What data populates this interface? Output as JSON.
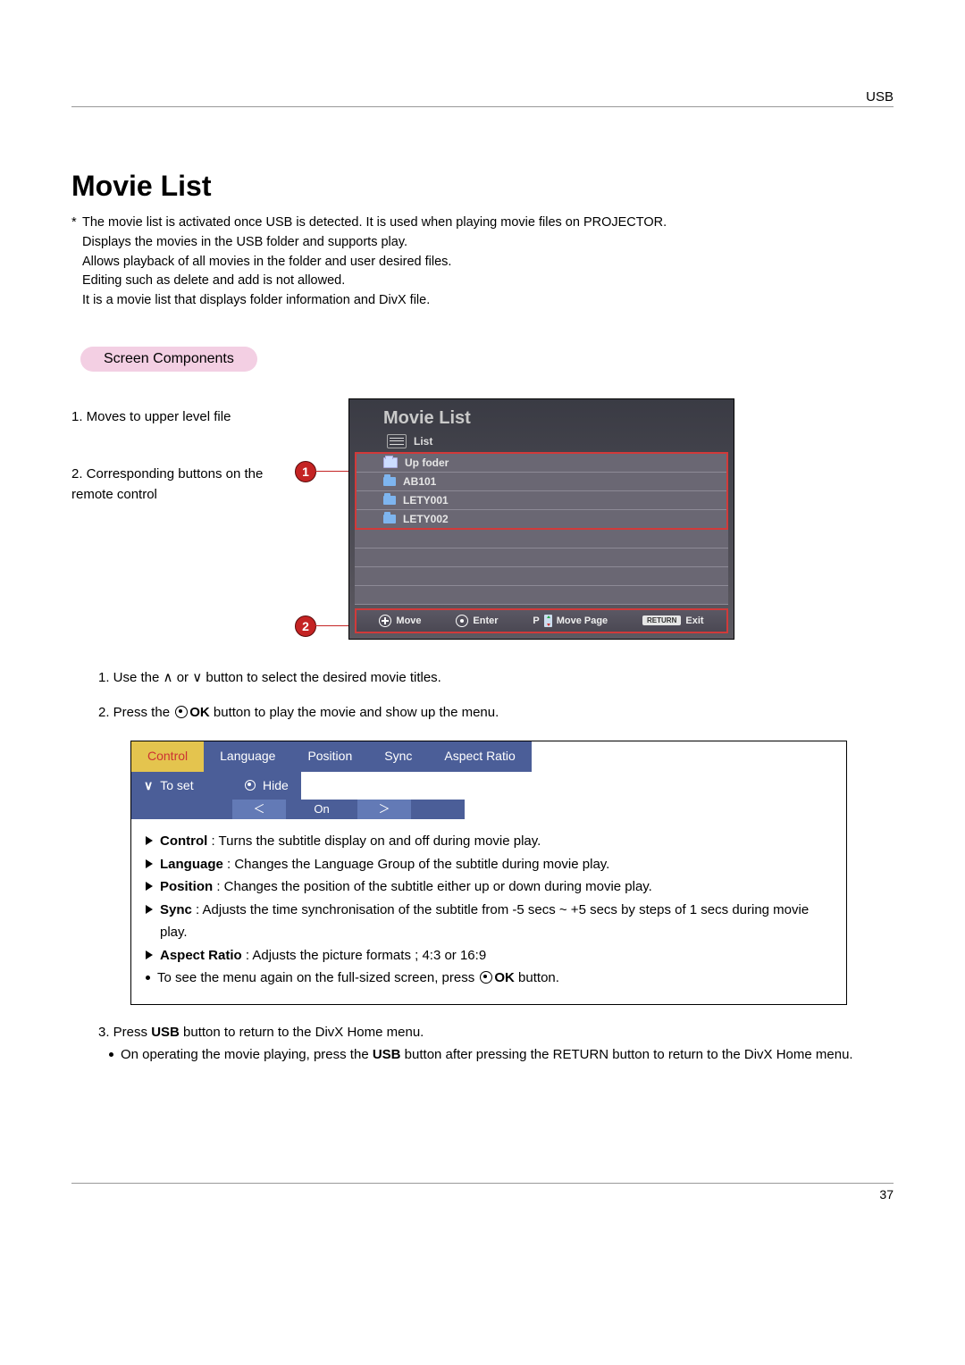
{
  "header": {
    "section": "USB"
  },
  "title": "Movie List",
  "intro": [
    "The movie list is activated once USB is detected. It is used when playing movie files on PROJECTOR.",
    "Displays the movies in the USB folder and supports play.",
    "Allows playback of all movies in the folder and user desired files.",
    "Editing such as delete and add is not allowed.",
    "It is a movie list that displays folder information and DivX file."
  ],
  "pill": "Screen Components",
  "leftnotes": {
    "n1": "1. Moves to upper level file",
    "n2": "2. Corresponding buttons on the remote control"
  },
  "badges": {
    "b1": "1",
    "b2": "2"
  },
  "ui": {
    "title": "Movie List",
    "listLabel": "List",
    "items": [
      {
        "type": "up",
        "label": "Up foder"
      },
      {
        "type": "folder",
        "label": "AB101"
      },
      {
        "type": "folder",
        "label": "LETY001"
      },
      {
        "type": "folder",
        "label": "LETY002"
      }
    ],
    "footer": {
      "move": "Move",
      "enter": "Enter",
      "p": "P",
      "movepage": "Move Page",
      "return": "RETURN",
      "exit": "Exit"
    }
  },
  "steps": {
    "s1a": "1. Use the ",
    "s1b": " or ",
    "s1c": " button to select the desired movie titles.",
    "s2a": "2. Press the ",
    "s2b": "OK",
    "s2c": " button to play the movie and show up the menu."
  },
  "subtitle": {
    "tabs": [
      "Control",
      "Language",
      "Position",
      "Sync",
      "Aspect Ratio"
    ],
    "row2": {
      "toset": "To set",
      "hide": "Hide"
    },
    "row3": {
      "lt": "＜",
      "on": "On",
      "gt": "＞"
    },
    "items": [
      {
        "term": "Control",
        "text": " : Turns the subtitle display on and off during movie play."
      },
      {
        "term": "Language",
        "text": " : Changes the Language Group of the subtitle during movie play."
      },
      {
        "term": "Position",
        "text": " : Changes the position of the subtitle either up or down during movie play."
      },
      {
        "term": "Sync",
        "text": " : Adjusts the time synchronisation of the subtitle from -5 secs ~ +5 secs by steps of 1 secs during movie play."
      },
      {
        "term": "Aspect Ratio",
        "text": " : Adjusts the picture formats ; 4:3 or 16:9"
      }
    ],
    "footnote_a": "To see the menu again on the full-sized screen, press ",
    "footnote_b": "OK",
    "footnote_c": " button."
  },
  "step3": {
    "line1a": "3. Press ",
    "line1b": "USB",
    "line1c": " button to return to the DivX Home menu.",
    "bullet_a": "On operating the movie playing, press the ",
    "bullet_b": "USB",
    "bullet_c": " button after pressing the RETURN button to return to the DivX Home menu."
  },
  "pageNumber": "37"
}
